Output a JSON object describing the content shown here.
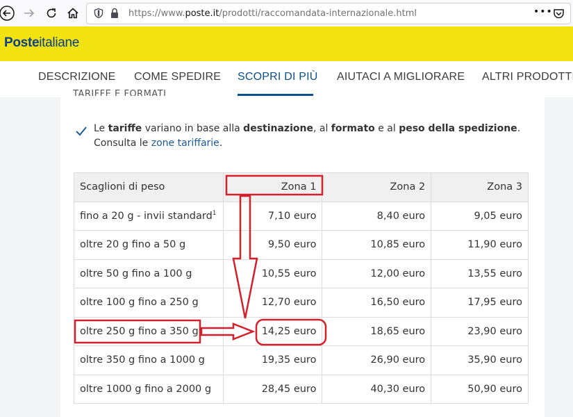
{
  "browser": {
    "url_prefix": "https://www.",
    "url_domain": "poste.it",
    "url_path": "/prodotti/raccomandata-internazionale.html"
  },
  "brand": {
    "logo_bold": "Poste",
    "logo_light": "italiane"
  },
  "tabs": [
    {
      "label": "DESCRIZIONE"
    },
    {
      "label": "COME SPEDIRE"
    },
    {
      "label": "SCOPRI DI PIÙ"
    },
    {
      "label": "AIUTACI A MIGLIORARE"
    },
    {
      "label": "ALTRI PRODOTTI"
    }
  ],
  "section_heading": "TARIFFE E FORMATI",
  "info": {
    "t1": "Le ",
    "b1": "tariffe",
    "t2": " variano in base alla ",
    "b2": "destinazione",
    "t3": ", al ",
    "b3": "formato",
    "t4": " e al ",
    "b4": "peso della spedizione",
    "t5": ".",
    "t6": "Consulta le ",
    "link": "zone tariffarie",
    "t7": "."
  },
  "table": {
    "headers": [
      "Scaglioni di peso",
      "Zona 1",
      "Zona 2",
      "Zona 3"
    ],
    "footnote_mark": "1",
    "rows": [
      [
        "fino a 20 g - invii standard",
        "7,10 euro",
        "8,40 euro",
        "9,05 euro"
      ],
      [
        "oltre 20 g fino a 50 g",
        "9,50 euro",
        "10,85 euro",
        "11,90 euro"
      ],
      [
        "oltre 50 g fino a 100 g",
        "10,55 euro",
        "12,00 euro",
        "13,55 euro"
      ],
      [
        "oltre 100 g fino a 250 g",
        "12,70 euro",
        "16,50 euro",
        "17,95 euro"
      ],
      [
        "oltre 250 g fino a 350 g",
        "14,25 euro",
        "18,65 euro",
        "23,90 euro"
      ],
      [
        "oltre 350 g fino a 1000 g",
        "19,35 euro",
        "26,90 euro",
        "35,90 euro"
      ],
      [
        "oltre 1000 g fino a 2000 g",
        "28,45 euro",
        "40,30 euro",
        "50,90 euro"
      ]
    ]
  },
  "colors": {
    "brand_yellow": "#f2e20f",
    "brand_blue": "#0a3f8c",
    "annotation_red": "#d3202a"
  }
}
